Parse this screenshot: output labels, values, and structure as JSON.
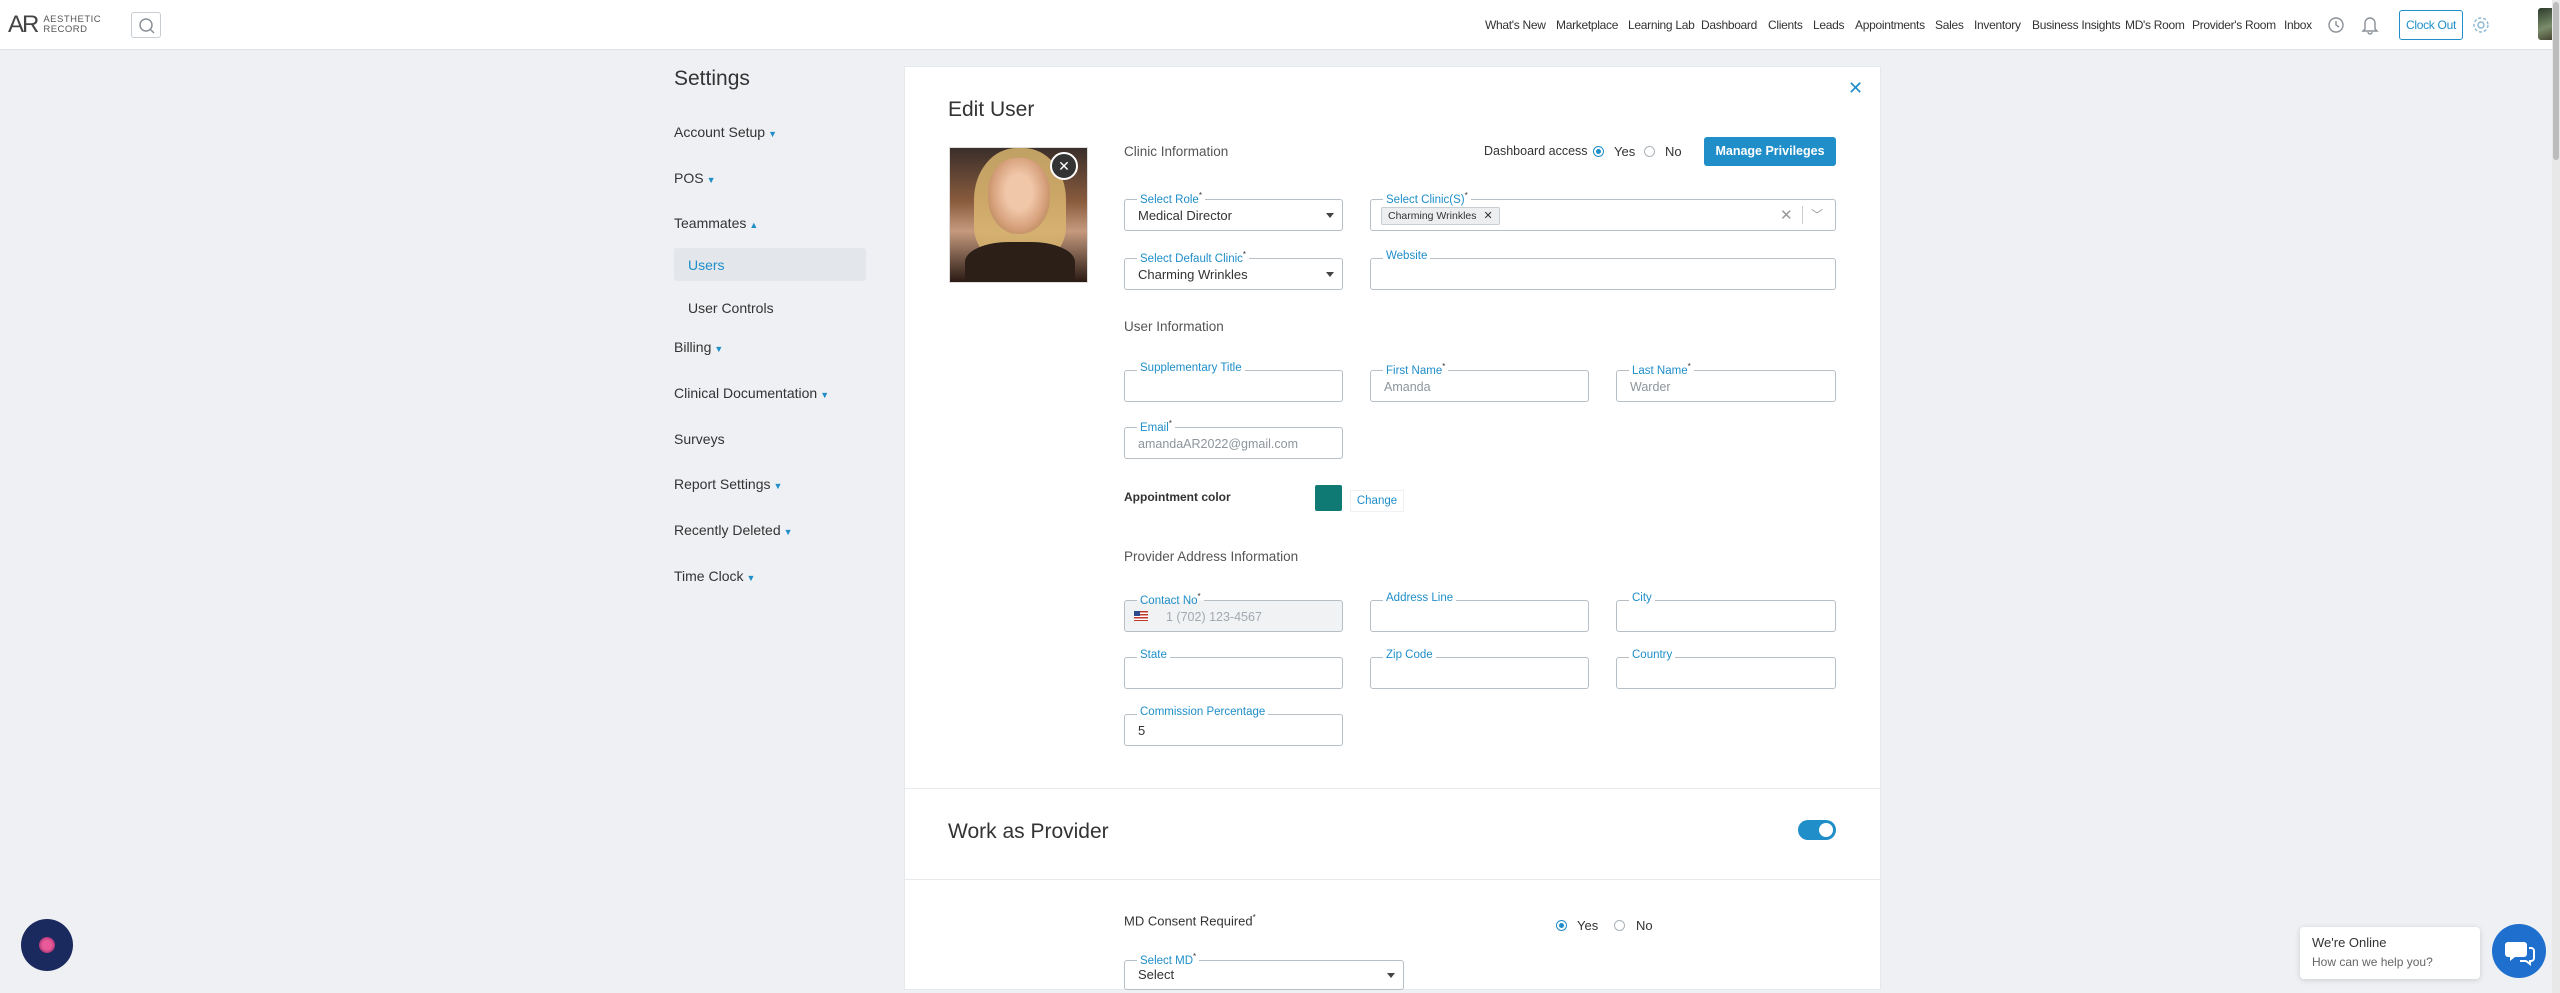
{
  "topbar": {
    "logo_mark": "AR",
    "logo_line1": "AESTHETIC",
    "logo_line2": "RECORD",
    "nav": [
      "What's New",
      "Marketplace",
      "Learning Lab",
      "Dashboard",
      "Clients",
      "Leads",
      "Appointments",
      "Sales",
      "Inventory",
      "Business Insights",
      "MD's Room",
      "Provider's Room",
      "Inbox"
    ],
    "clock_out": "Clock Out",
    "icons": [
      "search-icon",
      "clock-icon",
      "bell-icon",
      "gear-icon"
    ]
  },
  "sidebar": {
    "title": "Settings",
    "items": [
      {
        "label": "Account Setup",
        "chevron": "down"
      },
      {
        "label": "POS",
        "chevron": "down"
      },
      {
        "label": "Teammates",
        "chevron": "up"
      },
      {
        "label": "Billing",
        "chevron": "down"
      },
      {
        "label": "Clinical Documentation",
        "chevron": "down"
      },
      {
        "label": "Surveys",
        "chevron": ""
      },
      {
        "label": "Report Settings",
        "chevron": "down"
      },
      {
        "label": "Recently Deleted",
        "chevron": "down"
      },
      {
        "label": "Time Clock",
        "chevron": "down"
      }
    ],
    "sub_items": [
      {
        "label": "Users",
        "active": true
      },
      {
        "label": "User Controls",
        "active": false
      }
    ]
  },
  "edit_user": {
    "title": "Edit User",
    "clinic_info_label": "Clinic Information",
    "dashboard_access_label": "Dashboard access",
    "dashboard_access_yes": "Yes",
    "dashboard_access_no": "No",
    "dashboard_access_value": "Yes",
    "manage_privileges": "Manage Privileges",
    "select_role_label": "Select Role",
    "select_role_value": "Medical Director",
    "select_clinics_label": "Select Clinic(S)",
    "select_clinics_chip": "Charming Wrinkles",
    "select_default_clinic_label": "Select Default Clinic",
    "select_default_clinic_value": "Charming Wrinkles",
    "website_label": "Website",
    "website_value": "",
    "user_info_label": "User Information",
    "supplementary_title_label": "Supplementary Title",
    "supplementary_title_value": "",
    "first_name_label": "First Name",
    "first_name_value": "Amanda",
    "last_name_label": "Last Name",
    "last_name_value": "Warder",
    "email_label": "Email",
    "email_value": "amandaAR2022@gmail.com",
    "appointment_color_label": "Appointment color",
    "appointment_color": "#0e7a73",
    "change_label": "Change",
    "provider_address_label": "Provider Address Information",
    "contact_no_label": "Contact No",
    "contact_no_placeholder": "1 (702) 123-4567",
    "address_line_label": "Address Line",
    "city_label": "City",
    "state_label": "State",
    "zip_code_label": "Zip Code",
    "country_label": "Country",
    "commission_label": "Commission Percentage",
    "commission_value": "5",
    "required_mark": "*"
  },
  "work_as_provider": {
    "title": "Work as Provider",
    "enabled": true,
    "md_consent_label": "MD Consent Required",
    "md_consent_yes": "Yes",
    "md_consent_no": "No",
    "md_consent_value": "Yes",
    "select_md_label": "Select MD",
    "select_md_value": "Select"
  },
  "chat": {
    "online_title": "We're Online",
    "online_sub": "How can we help you?"
  },
  "colors": {
    "accent": "#1f8ec9",
    "swatch": "#0e7a73"
  }
}
